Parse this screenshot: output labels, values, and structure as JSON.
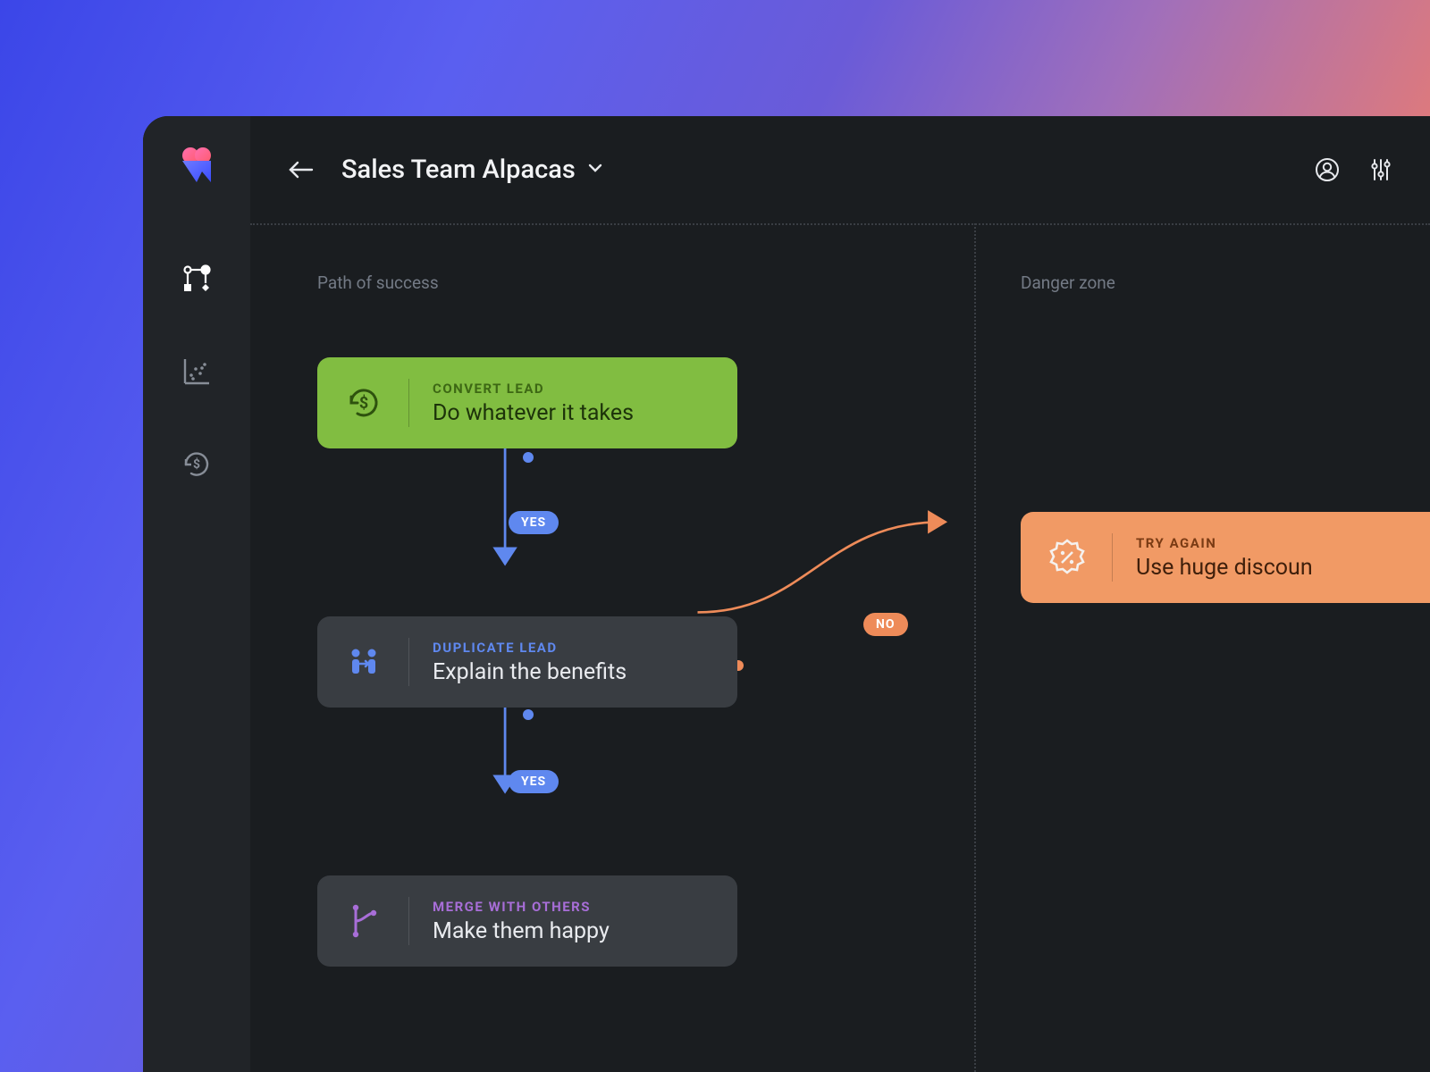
{
  "header": {
    "title": "Sales Team Alpacas"
  },
  "lanes": {
    "left": "Path of success",
    "right": "Danger zone"
  },
  "cards": {
    "convert": {
      "eyebrow": "CONVERT LEAD",
      "title": "Do whatever it takes"
    },
    "duplicate": {
      "eyebrow": "DUPLICATE LEAD",
      "title": "Explain the benefits"
    },
    "merge": {
      "eyebrow": "MERGE WITH OTHERS",
      "title": "Make them happy"
    },
    "tryagain": {
      "eyebrow": "TRY AGAIN",
      "title": "Use huge discoun"
    }
  },
  "pills": {
    "yes": "YES",
    "no": "NO"
  },
  "colors": {
    "green": "#81bd41",
    "dark": "#393d42",
    "orange": "#f19a65",
    "connector_blue": "#5f88ef",
    "connector_orange": "#ee8b59"
  }
}
